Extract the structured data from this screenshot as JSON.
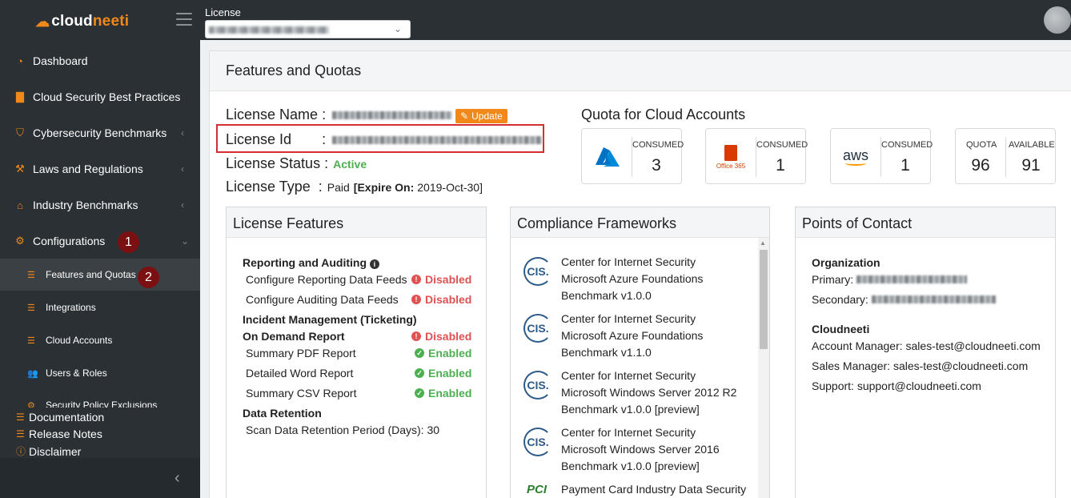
{
  "app": {
    "logo_text_a": "cloud",
    "logo_text_b": "neeti"
  },
  "topbar": {
    "license_label": "License"
  },
  "sidebar": {
    "items": [
      {
        "label": "Dashboard",
        "icon": "dashboard-icon"
      },
      {
        "label": "Cloud Security Best Practices",
        "icon": "briefcase-icon"
      },
      {
        "label": "Cybersecurity Benchmarks",
        "icon": "shield-icon"
      },
      {
        "label": "Laws and Regulations",
        "icon": "gavel-icon"
      },
      {
        "label": "Industry Benchmarks",
        "icon": "bank-icon"
      },
      {
        "label": "Configurations",
        "icon": "gear-icon"
      }
    ],
    "sub_items": [
      {
        "label": "Features and Quotas",
        "icon": "list-icon"
      },
      {
        "label": "Integrations",
        "icon": "list-icon"
      },
      {
        "label": "Cloud Accounts",
        "icon": "list-icon"
      },
      {
        "label": "Users & Roles",
        "icon": "users-icon"
      },
      {
        "label": "Security Policy Exclusions",
        "icon": "cogs-icon"
      }
    ],
    "footer": [
      {
        "label": "Documentation",
        "icon": "list-icon"
      },
      {
        "label": "Release Notes",
        "icon": "list-icon"
      },
      {
        "label": "Disclaimer",
        "icon": "info-circle-icon"
      }
    ],
    "markers": {
      "configurations": "1",
      "features": "2"
    }
  },
  "main": {
    "title": "Features and Quotas",
    "license": {
      "name_label": "License Name",
      "sep": ":",
      "update_label": "Update",
      "id_label": "License Id",
      "status_label": "License Status",
      "status_value": "Active",
      "type_label": "License Type",
      "type_value": "Paid",
      "expire_label": "Expire On:",
      "expire_value": "2019-Oct-30",
      "bracket_open": "[",
      "bracket_close": "]"
    },
    "quota": {
      "title": "Quota for Cloud Accounts",
      "consumed_label": "CONSUMED",
      "azure_consumed": "3",
      "office_consumed": "1",
      "office_logo": "Office 365",
      "aws_consumed": "1",
      "aws_logo": "aws",
      "quota_label": "QUOTA",
      "quota_value": "96",
      "available_label": "AVAILABLE",
      "available_value": "91"
    },
    "features": {
      "title": "License Features",
      "reporting_heading": "Reporting and Auditing",
      "reporting_rows": [
        {
          "label": "Configure Reporting Data Feeds",
          "status": "Disabled"
        },
        {
          "label": "Configure Auditing Data Feeds",
          "status": "Disabled"
        }
      ],
      "incident_heading": "Incident Management (Ticketing)",
      "on_demand_label": "On Demand Report",
      "on_demand_status": "Disabled",
      "report_rows": [
        {
          "label": "Summary PDF Report",
          "status": "Enabled"
        },
        {
          "label": "Detailed Word Report",
          "status": "Enabled"
        },
        {
          "label": "Summary CSV Report",
          "status": "Enabled"
        }
      ],
      "retention_heading": "Data Retention",
      "retention_row": "Scan Data Retention Period (Days): 30"
    },
    "compliance": {
      "title": "Compliance Frameworks",
      "cis_logo": "CIS.",
      "pci_logo": "PCI",
      "items": [
        {
          "line1": "Center for Internet Security",
          "line2": "Microsoft Azure Foundations",
          "line3": "Benchmark v1.0.0"
        },
        {
          "line1": "Center for Internet Security",
          "line2": "Microsoft Azure Foundations",
          "line3": "Benchmark v1.1.0"
        },
        {
          "line1": "Center for Internet Security",
          "line2": "Microsoft Windows Server 2012 R2",
          "line3": "Benchmark v1.0.0 [preview]"
        },
        {
          "line1": "Center for Internet Security",
          "line2": "Microsoft Windows Server 2016",
          "line3": "Benchmark v1.0.0 [preview]"
        }
      ],
      "last_item": "Payment Card Industry Data Security"
    },
    "contact": {
      "title": "Points of Contact",
      "org_heading": "Organization",
      "primary_label": "Primary:",
      "secondary_label": "Secondary:",
      "cloudneeti_heading": "Cloudneeti",
      "account_manager": "Account Manager: sales-test@cloudneeti.com",
      "sales_manager": "Sales Manager: sales-test@cloudneeti.com",
      "support": "Support: support@cloudneeti.com"
    }
  }
}
